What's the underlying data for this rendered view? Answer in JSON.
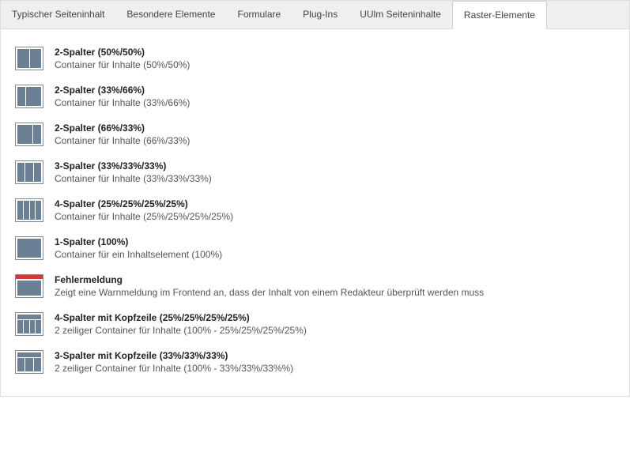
{
  "tabs": [
    {
      "label": "Typischer Seiteninhalt",
      "active": false
    },
    {
      "label": "Besondere Elemente",
      "active": false
    },
    {
      "label": "Formulare",
      "active": false
    },
    {
      "label": "Plug-Ins",
      "active": false
    },
    {
      "label": "UUlm Seiteninhalte",
      "active": false
    },
    {
      "label": "Raster-Elemente",
      "active": true
    }
  ],
  "items": [
    {
      "icon": "cols-2-50-50",
      "title": "2-Spalter (50%/50%)",
      "desc": "Container für Inhalte (50%/50%)"
    },
    {
      "icon": "cols-2-33-66",
      "title": "2-Spalter (33%/66%)",
      "desc": "Container für Inhalte (33%/66%)"
    },
    {
      "icon": "cols-2-66-33",
      "title": "2-Spalter (66%/33%)",
      "desc": "Container für Inhalte (66%/33%)"
    },
    {
      "icon": "cols-3",
      "title": "3-Spalter (33%/33%/33%)",
      "desc": "Container für Inhalte (33%/33%/33%)"
    },
    {
      "icon": "cols-4",
      "title": "4-Spalter (25%/25%/25%/25%)",
      "desc": "Container für Inhalte (25%/25%/25%/25%)"
    },
    {
      "icon": "cols-1",
      "title": "1-Spalter (100%)",
      "desc": "Container für ein Inhaltselement (100%)"
    },
    {
      "icon": "error",
      "title": "Fehlermeldung",
      "desc": "Zeigt eine Warnmeldung im Frontend an, dass der Inhalt von einem Redakteur überprüft werden muss"
    },
    {
      "icon": "head-cols-4",
      "title": "4-Spalter mit Kopfzeile (25%/25%/25%/25%)",
      "desc": "2 zeiliger Container für Inhalte (100% - 25%/25%/25%/25%)"
    },
    {
      "icon": "head-cols-3",
      "title": "3-Spalter mit Kopfzeile (33%/33%/33%)",
      "desc": "2 zeiliger Container für Inhalte (100% - 33%/33%/33%%)"
    }
  ]
}
